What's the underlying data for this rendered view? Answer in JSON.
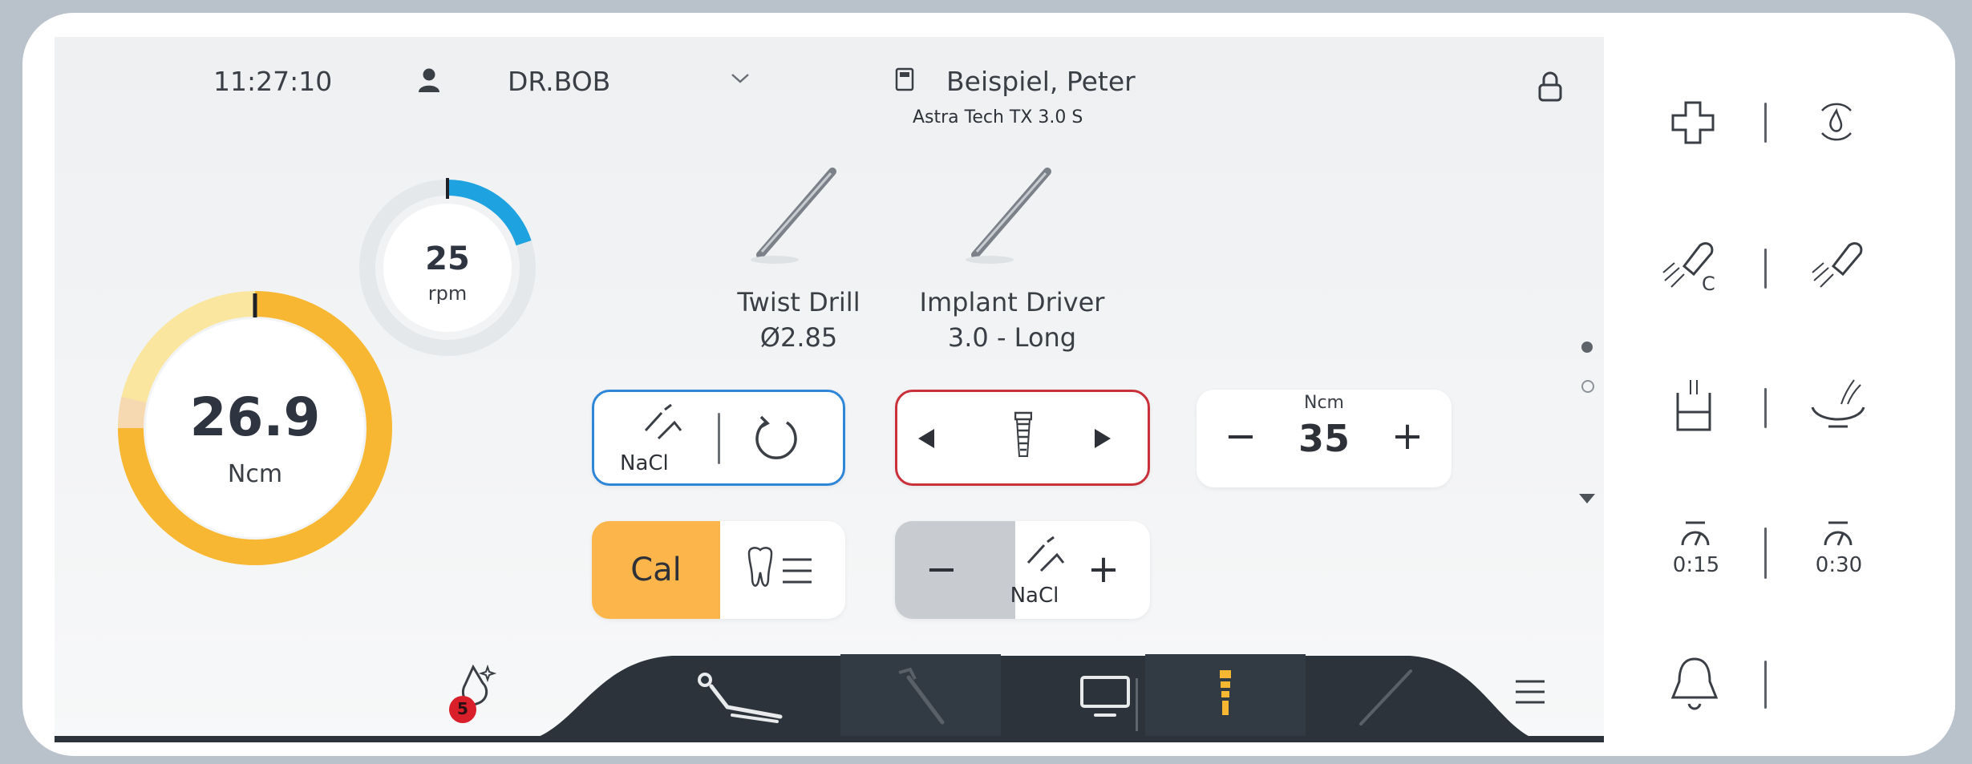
{
  "status_bar": {
    "time": "11:27:10",
    "user": "DR.BOB",
    "patient_name": "Beispiel, Peter",
    "implant_system": "Astra Tech TX 3.0 S"
  },
  "gauges": {
    "speed": {
      "value": "25",
      "unit": "rpm",
      "fill_fraction": 0.2
    },
    "torque": {
      "value": "26.9",
      "unit": "Ncm",
      "fill_fraction": 0.75,
      "limit_fraction": 0.77
    }
  },
  "instruments": [
    {
      "name": "Twist Drill",
      "detail": "Ø2.85"
    },
    {
      "name": "Implant Driver",
      "detail": "3.0 - Long"
    }
  ],
  "controls": {
    "coolant_label": "NaCl",
    "torque_limit_unit": "Ncm",
    "torque_limit_value": "35",
    "minus_symbol": "−",
    "plus_symbol": "+",
    "calibration_label": "Cal",
    "flow_coolant_label": "NaCl"
  },
  "bottom_bar": {
    "notification_count": "5"
  },
  "side_panel": {
    "timer_1": "0:15",
    "timer_2": "0:30"
  },
  "colors": {
    "accent_blue": "#2f86d8",
    "accent_red": "#c9303a",
    "torque_yellow": "#f7b733",
    "speed_blue": "#1ea3e0",
    "cal_orange": "#fbb54a",
    "nav_dark": "#2c333b",
    "badge_red": "#d81f2a"
  }
}
